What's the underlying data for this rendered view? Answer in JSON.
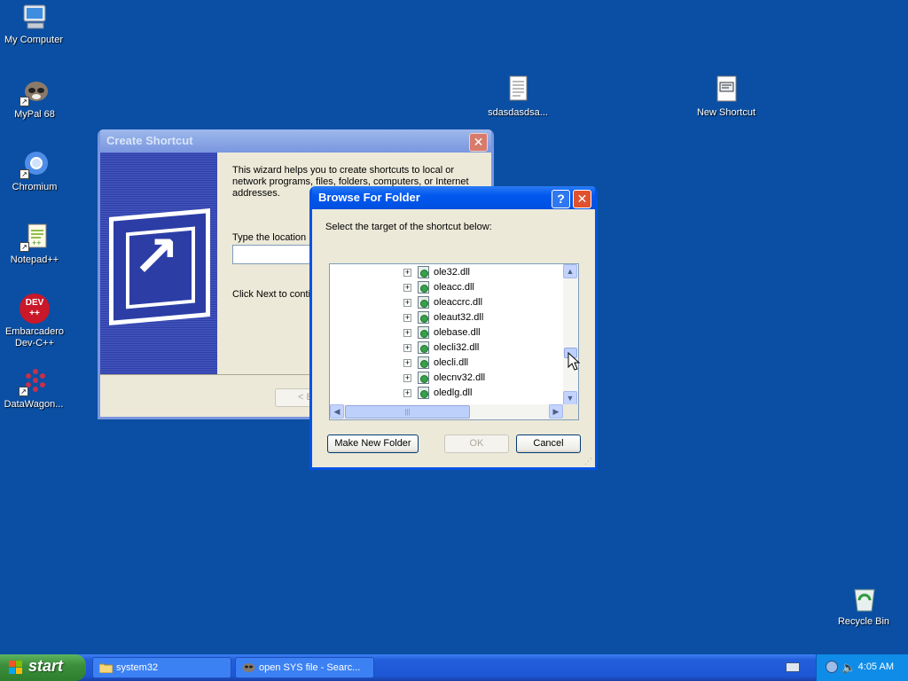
{
  "desktop": {
    "icons": [
      {
        "label": "My Computer",
        "icon": "my-computer-icon"
      },
      {
        "label": "MyPal 68",
        "icon": "raccoon-icon"
      },
      {
        "label": "Chromium",
        "icon": "chromium-icon"
      },
      {
        "label": "Notepad++",
        "icon": "notepad-plus-plus-icon"
      },
      {
        "label": "Embarcadero Dev-C++",
        "icon": "devcpp-icon",
        "badge": "DEV ++"
      },
      {
        "label": "DataWagon...",
        "icon": "datawagon-icon"
      },
      {
        "label": "sdasdasdsa...",
        "icon": "text-file-icon"
      },
      {
        "label": "New Shortcut",
        "icon": "shortcut-file-icon"
      },
      {
        "label": "Recycle Bin",
        "icon": "recycle-bin-icon"
      }
    ]
  },
  "create_shortcut": {
    "title": "Create Shortcut",
    "description": "This wizard helps you to create shortcuts to local or network programs, files, folders, computers, or Internet addresses.",
    "location_label": "Type the location",
    "location_value": "",
    "next_text": "Click Next to conti",
    "back_label": "< Ba"
  },
  "browse_folder": {
    "title": "Browse For Folder",
    "help_label": "?",
    "close_label": "✕",
    "prompt": "Select the target of the shortcut below:",
    "tree_items": [
      "ole32.dll",
      "oleacc.dll",
      "oleaccrc.dll",
      "oleaut32.dll",
      "olebase.dll",
      "olecli32.dll",
      "olecli.dll",
      "olecnv32.dll",
      "oledlg.dll"
    ],
    "make_new_folder_label": "Make New Folder",
    "ok_label": "OK",
    "cancel_label": "Cancel"
  },
  "taskbar": {
    "start_label": "start",
    "tasks": [
      {
        "label": "system32",
        "icon": "folder-icon"
      },
      {
        "label": "open SYS file - Searc...",
        "icon": "raccoon-icon"
      }
    ],
    "clock": "4:05 AM"
  },
  "colors": {
    "desktop": "#0a4fa3",
    "active_title": "#0058ee",
    "inactive_title": "#7a96df",
    "taskbar": "#245edb",
    "start_button": "#3c8f3c"
  }
}
